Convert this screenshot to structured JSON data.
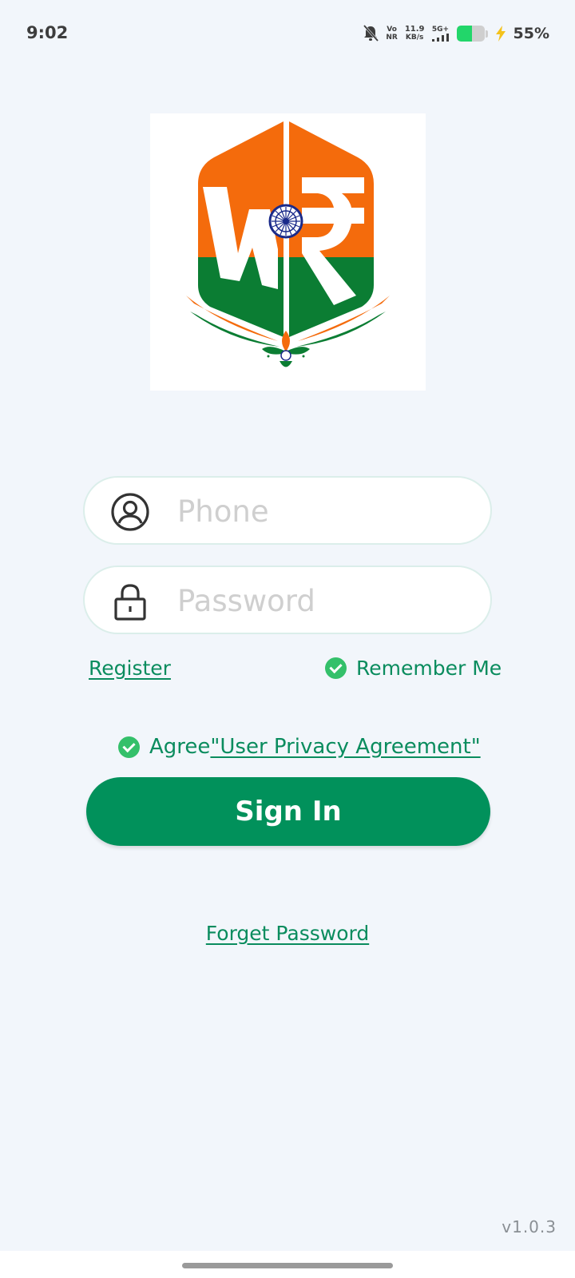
{
  "status_bar": {
    "time": "9:02",
    "vo": "Vo",
    "nr": "NR",
    "speed_value": "11.9",
    "speed_unit": "KB/s",
    "network": "5G+",
    "battery_percent": "55%",
    "battery_level": 0.55,
    "mute_icon": "bell-off-icon",
    "charging_icon": "bolt-icon"
  },
  "logo": {
    "icon": "wr-rupee-logo"
  },
  "form": {
    "phone": {
      "placeholder": "Phone",
      "value": "",
      "icon": "user-circle-icon"
    },
    "password": {
      "placeholder": "Password",
      "value": "",
      "icon": "lock-icon"
    },
    "register_label": "Register",
    "remember_label": "Remember Me",
    "remember_checked": true,
    "agree_prefix": "Agree",
    "agree_link": "\"User Privacy Agreement\"",
    "agree_checked": true,
    "signin_label": "Sign In",
    "forget_label": "Forget Password"
  },
  "version": "v1.0.3",
  "colors": {
    "background": "#f2f6fb",
    "primary_green": "#01915b",
    "link_green": "#0a8c5e",
    "check_green": "#34c06a",
    "saffron": "#f46b0c",
    "india_green": "#0b7d33",
    "chakra_blue": "#1a2a8a"
  }
}
